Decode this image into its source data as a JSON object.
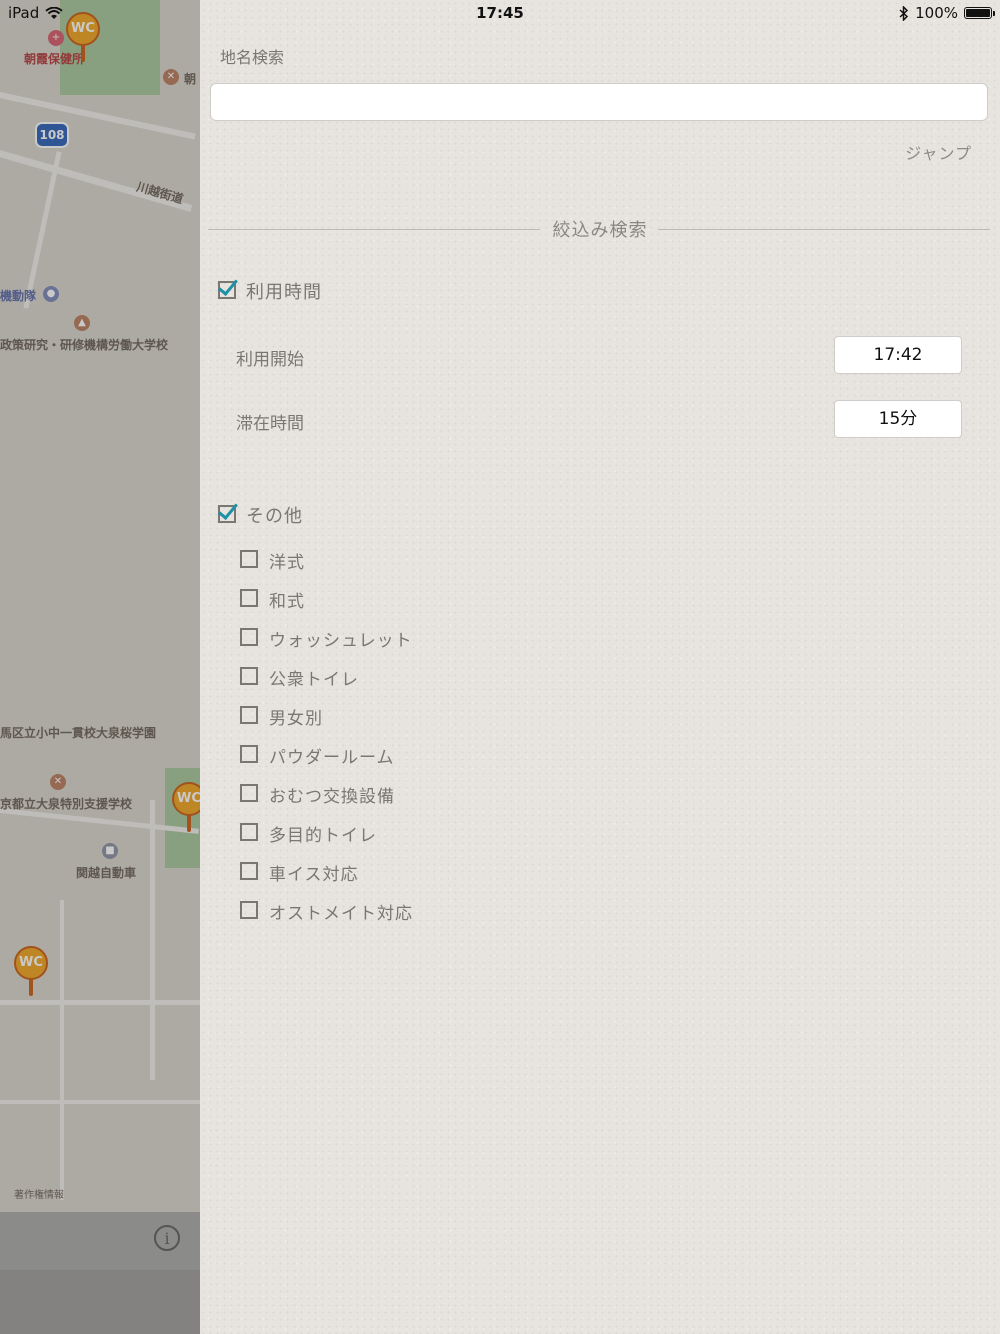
{
  "status_bar": {
    "device": "iPad",
    "time": "17:45",
    "battery": "100%"
  },
  "map": {
    "labels": {
      "hoken": "朝霞保健所",
      "asa": "朝",
      "route_number": "108",
      "kawagoe": "川越街道",
      "kidotai": "機動隊",
      "seisaku": "政策研究・研修機構労働大学校",
      "nerima_school": "馬区立小中一貫校大泉桜学園",
      "tokyo_school": "京都立大泉特別支援学校",
      "kanetsu": "関越自動車",
      "copyright": "著作権情報",
      "wc": "WC"
    },
    "info_label": "i"
  },
  "panel": {
    "place_search_label": "地名検索",
    "search_value": "",
    "jump_label": "ジャンプ",
    "filter_section_title": "絞込み検索",
    "usage_time": {
      "label": "利用時間",
      "checked": true,
      "start_label": "利用開始",
      "start_value": "17:42",
      "stay_label": "滞在時間",
      "stay_value": "15分"
    },
    "other": {
      "label": "その他",
      "checked": true,
      "options": [
        {
          "label": "洋式",
          "checked": false
        },
        {
          "label": "和式",
          "checked": false
        },
        {
          "label": "ウォッシュレット",
          "checked": false
        },
        {
          "label": "公衆トイレ",
          "checked": false
        },
        {
          "label": "男女別",
          "checked": false
        },
        {
          "label": "パウダールーム",
          "checked": false
        },
        {
          "label": "おむつ交換設備",
          "checked": false
        },
        {
          "label": "多目的トイレ",
          "checked": false
        },
        {
          "label": "車イス対応",
          "checked": false
        },
        {
          "label": "オストメイト対応",
          "checked": false
        }
      ]
    }
  },
  "colors": {
    "accent_check": "#1d8fa6",
    "panel_bg": "#e7e4df",
    "wc_pin": "#f0a21b"
  }
}
